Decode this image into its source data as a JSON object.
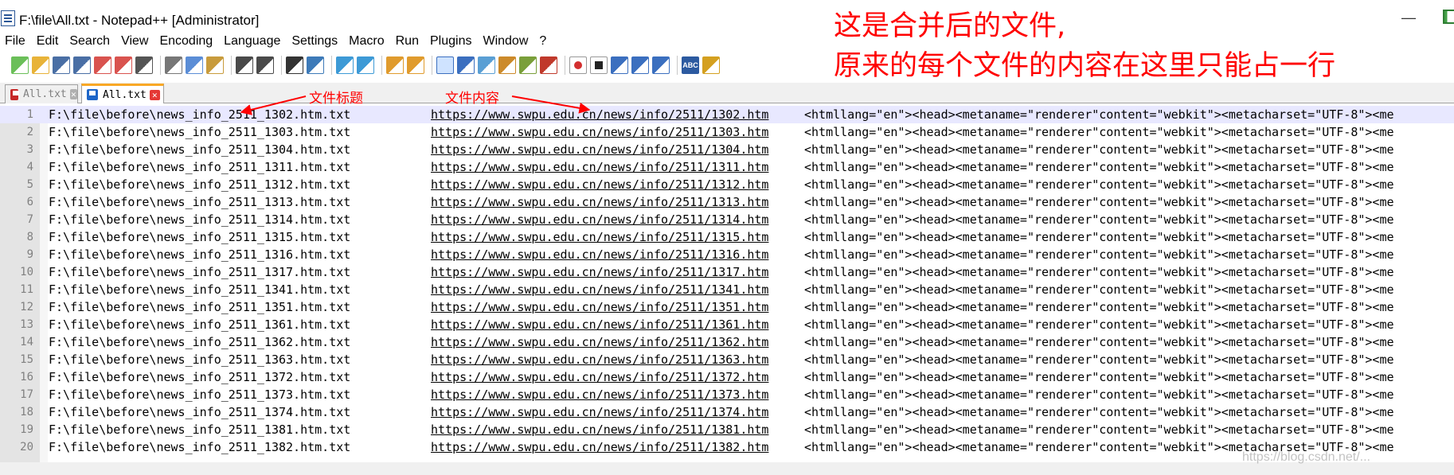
{
  "window": {
    "title": "F:\\file\\All.txt - Notepad++ [Administrator]",
    "minimize_glyph": "—"
  },
  "menu": [
    "File",
    "Edit",
    "Search",
    "View",
    "Encoding",
    "Language",
    "Settings",
    "Macro",
    "Run",
    "Plugins",
    "Window",
    "?"
  ],
  "toolbar": {
    "icons": [
      "new-file-icon",
      "open-file-icon",
      "save-icon",
      "save-all-icon",
      "close-icon",
      "close-all-icon",
      "print-icon",
      "sep",
      "cut-icon",
      "copy-icon",
      "paste-icon",
      "sep",
      "undo-icon",
      "redo-icon",
      "sep",
      "find-icon",
      "replace-icon",
      "sep",
      "zoom-in-icon",
      "zoom-out-icon",
      "sep",
      "sync-vertical-icon",
      "sync-horizontal-icon",
      "sep",
      "word-wrap-icon",
      "show-all-chars-icon",
      "indent-guide-icon",
      "user-lang-icon",
      "document-map-icon",
      "function-list-icon",
      "sep",
      "record-macro-icon",
      "stop-macro-icon",
      "play-macro-icon",
      "run-macro-multiple-icon",
      "save-macro-icon",
      "sep",
      "spell-check-icon",
      "spell-settings-icon"
    ],
    "spell_label": "ABC"
  },
  "tabs": [
    {
      "label": "All.txt",
      "active": false
    },
    {
      "label": "All.txt",
      "active": true
    }
  ],
  "annotations": {
    "top_line1": "这是合并后的文件,",
    "top_line2": "原来的每个文件的内容在这里只能占一行",
    "title_label": "文件标题",
    "content_label": "文件内容"
  },
  "editor": {
    "html_snippet": "<htmllang=\"en\"><head><metaname=\"renderer\"content=\"webkit\"><metacharset=\"UTF-8\"><me",
    "lines": [
      {
        "n": "1",
        "file": "F:\\file\\before\\news_info_2511_1302.htm.txt",
        "url": "https://www.swpu.edu.cn/news/info/2511/1302.htm"
      },
      {
        "n": "2",
        "file": "F:\\file\\before\\news_info_2511_1303.htm.txt",
        "url": "https://www.swpu.edu.cn/news/info/2511/1303.htm"
      },
      {
        "n": "3",
        "file": "F:\\file\\before\\news_info_2511_1304.htm.txt",
        "url": "https://www.swpu.edu.cn/news/info/2511/1304.htm"
      },
      {
        "n": "4",
        "file": "F:\\file\\before\\news_info_2511_1311.htm.txt",
        "url": "https://www.swpu.edu.cn/news/info/2511/1311.htm"
      },
      {
        "n": "5",
        "file": "F:\\file\\before\\news_info_2511_1312.htm.txt",
        "url": "https://www.swpu.edu.cn/news/info/2511/1312.htm"
      },
      {
        "n": "6",
        "file": "F:\\file\\before\\news_info_2511_1313.htm.txt",
        "url": "https://www.swpu.edu.cn/news/info/2511/1313.htm"
      },
      {
        "n": "7",
        "file": "F:\\file\\before\\news_info_2511_1314.htm.txt",
        "url": "https://www.swpu.edu.cn/news/info/2511/1314.htm"
      },
      {
        "n": "8",
        "file": "F:\\file\\before\\news_info_2511_1315.htm.txt",
        "url": "https://www.swpu.edu.cn/news/info/2511/1315.htm"
      },
      {
        "n": "9",
        "file": "F:\\file\\before\\news_info_2511_1316.htm.txt",
        "url": "https://www.swpu.edu.cn/news/info/2511/1316.htm"
      },
      {
        "n": "10",
        "file": "F:\\file\\before\\news_info_2511_1317.htm.txt",
        "url": "https://www.swpu.edu.cn/news/info/2511/1317.htm"
      },
      {
        "n": "11",
        "file": "F:\\file\\before\\news_info_2511_1341.htm.txt",
        "url": "https://www.swpu.edu.cn/news/info/2511/1341.htm"
      },
      {
        "n": "12",
        "file": "F:\\file\\before\\news_info_2511_1351.htm.txt",
        "url": "https://www.swpu.edu.cn/news/info/2511/1351.htm"
      },
      {
        "n": "13",
        "file": "F:\\file\\before\\news_info_2511_1361.htm.txt",
        "url": "https://www.swpu.edu.cn/news/info/2511/1361.htm"
      },
      {
        "n": "14",
        "file": "F:\\file\\before\\news_info_2511_1362.htm.txt",
        "url": "https://www.swpu.edu.cn/news/info/2511/1362.htm"
      },
      {
        "n": "15",
        "file": "F:\\file\\before\\news_info_2511_1363.htm.txt",
        "url": "https://www.swpu.edu.cn/news/info/2511/1363.htm"
      },
      {
        "n": "16",
        "file": "F:\\file\\before\\news_info_2511_1372.htm.txt",
        "url": "https://www.swpu.edu.cn/news/info/2511/1372.htm"
      },
      {
        "n": "17",
        "file": "F:\\file\\before\\news_info_2511_1373.htm.txt",
        "url": "https://www.swpu.edu.cn/news/info/2511/1373.htm"
      },
      {
        "n": "18",
        "file": "F:\\file\\before\\news_info_2511_1374.htm.txt",
        "url": "https://www.swpu.edu.cn/news/info/2511/1374.htm"
      },
      {
        "n": "19",
        "file": "F:\\file\\before\\news_info_2511_1381.htm.txt",
        "url": "https://www.swpu.edu.cn/news/info/2511/1381.htm"
      },
      {
        "n": "20",
        "file": "F:\\file\\before\\news_info_2511_1382.htm.txt",
        "url": "https://www.swpu.edu.cn/news/info/2511/1382.htm"
      }
    ]
  },
  "watermark": "https://blog.csdn.net/...",
  "colors": {
    "annotation_red": "#ff0000",
    "active_tab_accent": "#f9a825",
    "current_line": "#e8e8ff",
    "gutter": "#e4e4e4"
  }
}
